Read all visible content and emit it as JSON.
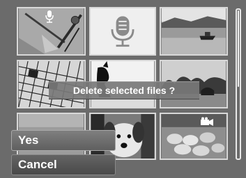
{
  "dialog": {
    "message": "Delete selected files ?"
  },
  "menu": {
    "yes_label": "Yes",
    "cancel_label": "Cancel"
  },
  "thumbnails": [
    {
      "name": "thumb-drawing-tools",
      "badge": "voice-memo-icon"
    },
    {
      "name": "thumb-voice-memo",
      "badge": "microphone-icon"
    },
    {
      "name": "thumb-boat-lake",
      "badge": ""
    },
    {
      "name": "thumb-crossword",
      "badge": ""
    },
    {
      "name": "thumb-dog-silhouette",
      "badge": ""
    },
    {
      "name": "thumb-trees-landscape",
      "badge": ""
    },
    {
      "name": "thumb-partial",
      "badge": ""
    },
    {
      "name": "thumb-dog-closeup",
      "badge": ""
    },
    {
      "name": "thumb-sheep-flock",
      "badge": "video-camera-icon"
    }
  ],
  "colors": {
    "background": "#6b6b6b",
    "border": "#d8d8d8",
    "text": "#ffffff"
  }
}
